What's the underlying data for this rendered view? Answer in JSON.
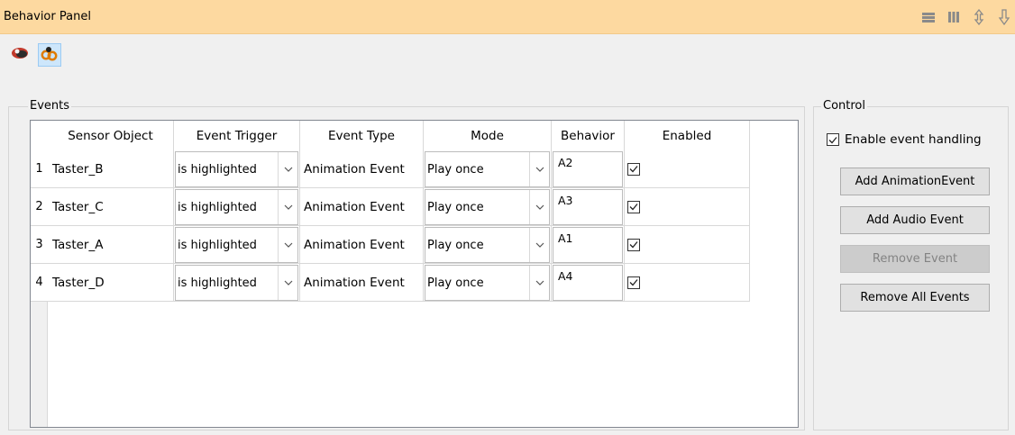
{
  "panel": {
    "title": "Behavior Panel"
  },
  "titlebar_icons": [
    "rows-icon",
    "columns-icon",
    "expand-vertical-icon",
    "dock-down-icon"
  ],
  "toolbar_icons": [
    "object-view-icon",
    "event-links-icon"
  ],
  "events": {
    "legend": "Events",
    "columns": [
      "Sensor Object",
      "Event Trigger",
      "Event Type",
      "Mode",
      "Behavior",
      "Enabled"
    ],
    "rows": [
      {
        "num": "1",
        "sensor": "Taster_B",
        "trigger": "is highlighted",
        "type": "Animation Event",
        "mode": "Play once",
        "behavior": "A2",
        "enabled": true
      },
      {
        "num": "2",
        "sensor": "Taster_C",
        "trigger": "is highlighted",
        "type": "Animation Event",
        "mode": "Play once",
        "behavior": "A3",
        "enabled": true
      },
      {
        "num": "3",
        "sensor": "Taster_A",
        "trigger": "is highlighted",
        "type": "Animation Event",
        "mode": "Play once",
        "behavior": "A1",
        "enabled": true
      },
      {
        "num": "4",
        "sensor": "Taster_D",
        "trigger": "is highlighted",
        "type": "Animation Event",
        "mode": "Play once",
        "behavior": "A4",
        "enabled": true
      }
    ]
  },
  "control": {
    "legend": "Control",
    "enable_label": "Enable event handling",
    "enable_checked": true,
    "buttons": {
      "add_animation": "Add AnimationEvent",
      "add_audio": "Add Audio Event",
      "remove": "Remove Event",
      "remove_all": "Remove All Events"
    }
  }
}
